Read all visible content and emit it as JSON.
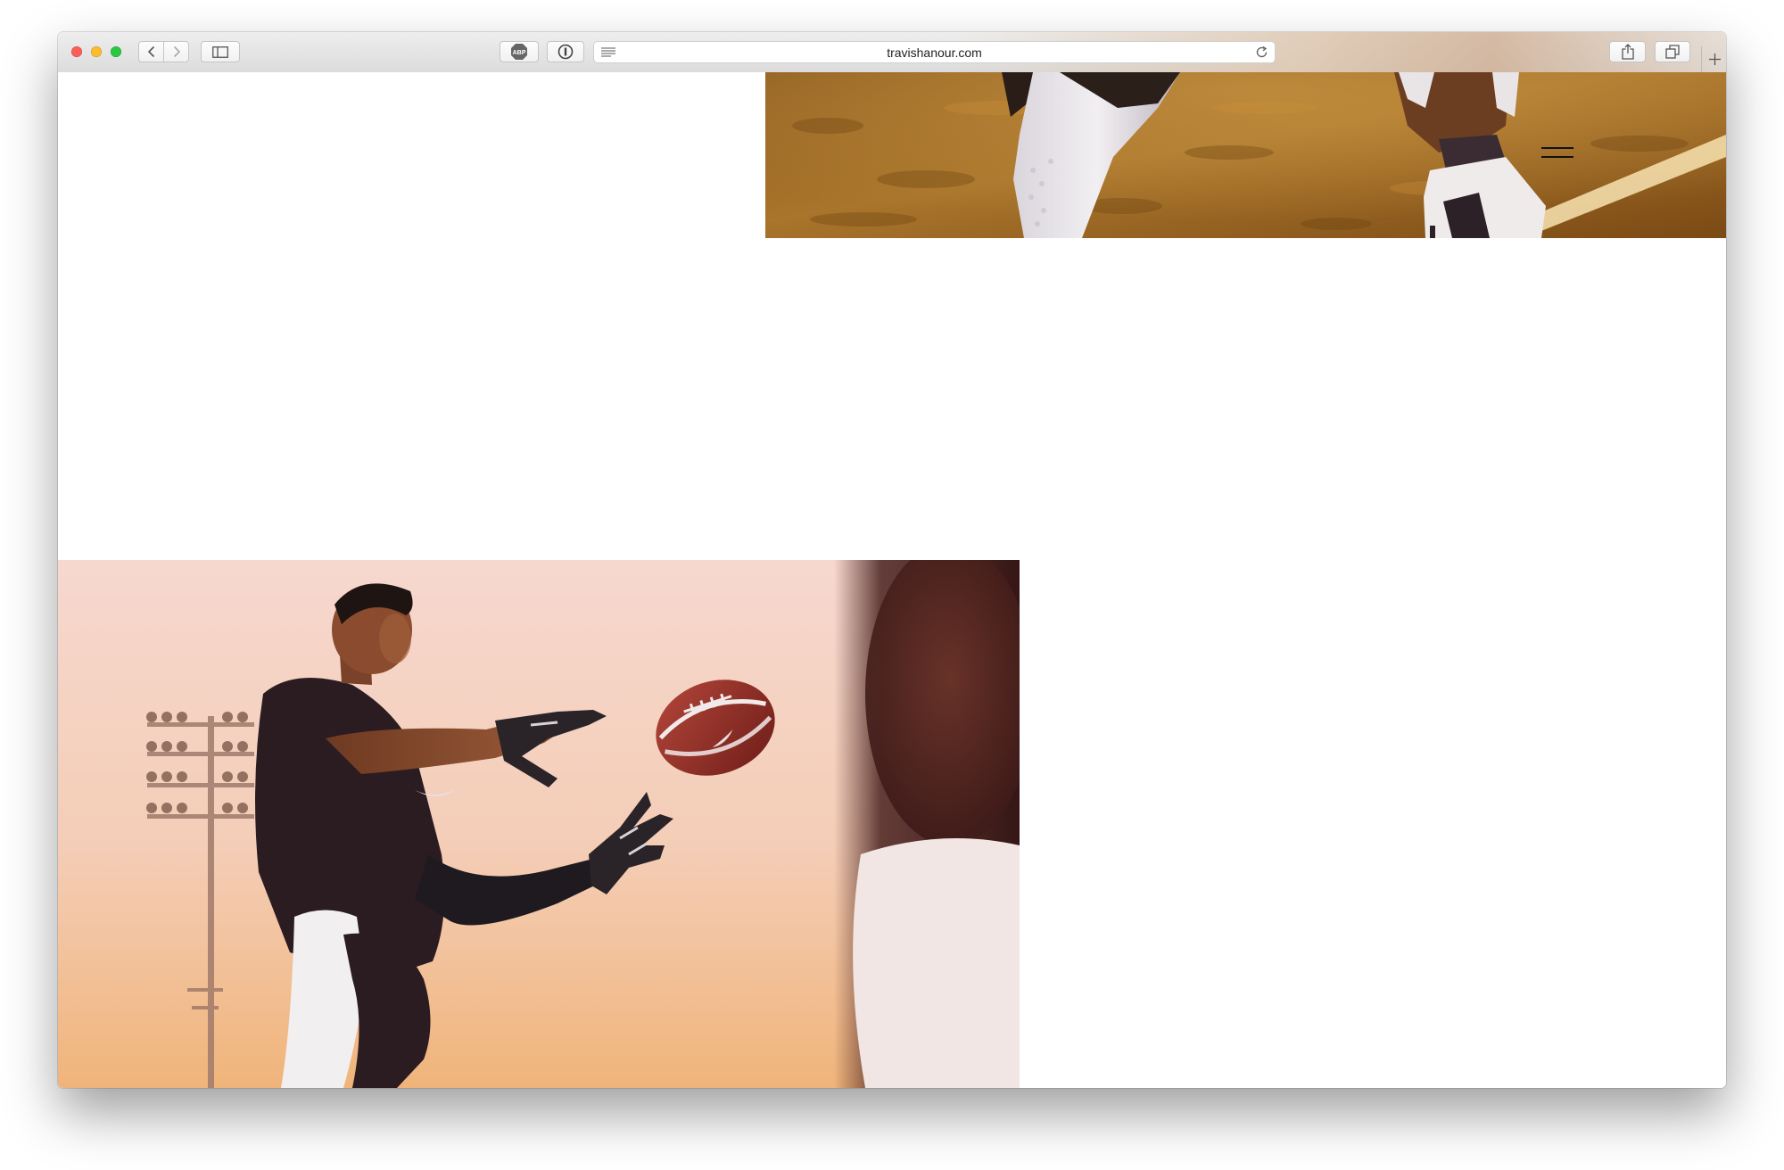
{
  "browser": {
    "url": "travishanour.com",
    "buttons": {
      "back": "chevron-left-icon",
      "forward": "chevron-right-icon",
      "sidebar": "sidebar-icon",
      "adblock": "abp-icon",
      "password": "1password-icon",
      "reader": "reader-icon",
      "reload": "reload-icon",
      "share": "share-icon",
      "tabs": "tabs-overview-icon",
      "new_tab": "plus-icon"
    },
    "adblock_label": "ABP"
  },
  "page": {
    "menu_icon": "hamburger-icon",
    "images": [
      {
        "name": "hero-top-image",
        "subject": "football player legs and cleats on field"
      },
      {
        "name": "hero-bottom-image",
        "subject": "football player catching ball at sunset"
      }
    ]
  },
  "colors": {
    "traffic_red": "#fc5f57",
    "traffic_yellow": "#fdbc2e",
    "traffic_green": "#29c840",
    "page_background": "#ffffff"
  }
}
